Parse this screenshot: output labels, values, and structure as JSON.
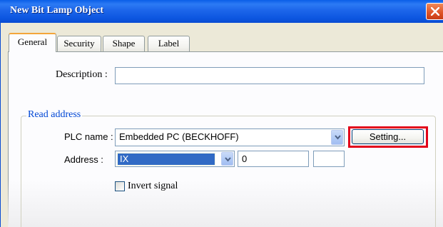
{
  "window": {
    "title": "New  Bit Lamp Object"
  },
  "tabs": [
    {
      "label": "General",
      "active": true
    },
    {
      "label": "Security",
      "active": false
    },
    {
      "label": "Shape",
      "active": false
    },
    {
      "label": "Label",
      "active": false
    }
  ],
  "general": {
    "description_label": "Description :",
    "description_value": ""
  },
  "read_address": {
    "group_title": "Read address",
    "plc_name_label": "PLC name :",
    "plc_name_value": "Embedded PC (BECKHOFF)",
    "setting_button": "Setting...",
    "address_label": "Address :",
    "address_type_value": "IX",
    "address_value": "0",
    "address_extra_value": "",
    "invert_signal_label": "Invert signal",
    "invert_signal_checked": false
  },
  "colors": {
    "titlebar": "#0a5ee8",
    "group_title": "#0046d5",
    "highlight_outline": "#e2001a",
    "selection": "#316ac5"
  }
}
